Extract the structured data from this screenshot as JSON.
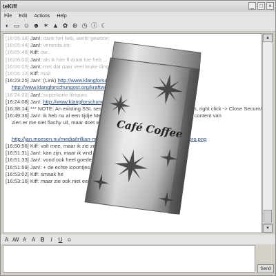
{
  "window": {
    "title": "teKiff"
  },
  "menu": [
    "File",
    "Edit",
    "Actions",
    "Help"
  ],
  "toolbar_icons": [
    "connect-icon",
    "folder-icon",
    "users-icon",
    "user-add-icon",
    "star-icon",
    "alert-icon",
    "settings-icon",
    "history-icon",
    "clock-icon",
    "info-icon",
    "moon-icon"
  ],
  "chat": {
    "lines": [
      {
        "ts": "[16:05:38]",
        "nick": "Jan!:",
        "msg": "dank het heb, werkt gewoon",
        "dim": true
      },
      {
        "ts": "[16:05:44]",
        "nick": "Jan!:",
        "msg": "veranda etc",
        "dim": true
      },
      {
        "ts": "[16:05:46]",
        "nick": "Kiff:",
        "msg": "ow...",
        "dim": true
      },
      {
        "ts": "[16:06:00]",
        "nick": "Jan!:",
        "msg": "als ik hier fl draai toe heb...",
        "dim": true
      },
      {
        "ts": "[16:06:05]",
        "nick": "Jan!:",
        "msg": "met dat daar veel leuke dingen",
        "dim": true
      },
      {
        "ts": "[16:06:12]",
        "nick": "Kiff:",
        "msg": "mail",
        "dim": true
      },
      {
        "ts": "[16:23:25]",
        "nick": "Jan!: (Link)",
        "msg": "",
        "dim": false,
        "link": "http://www.klangforschungost.org/kraftwerk_brussels04",
        "link2": "http://www.klangforschungost.org/kraftwerk_brussels04/vids/"
      },
      {
        "ts": "[16:24:02]",
        "nick": "Jan!:",
        "msg": "superkorte filmpjes",
        "dim": true
      },
      {
        "ts": "[16:24:08]",
        "nick": "Jan!:",
        "msg": "",
        "dim": false,
        "link": "http://www.klangforschungost.org/kraftwerk_brussels04/vids/"
      },
      {
        "ts": "[16:38:14]",
        "nick": "***",
        "msg": "NOTE: An existing SSL session exists with Kiff. To close this session, right click -> Close Secure/IM Session",
        "dim": false
      },
      {
        "ts": "[16:49:36]",
        "nick": "Jan!:",
        "msg": "ik heb nu al een tijdje Media Player 10 voor trillian, en ben er wel content van",
        "dim": false
      },
      {
        "ts": "",
        "nick": "",
        "msg": "zien er me niet flashy uit, maar doet wat het moet doen",
        "dim": false
      },
      {
        "ts": "",
        "nick": "",
        "msg": "",
        "dim": false,
        "link": "http://jan.moesen.nu/media/trillian-media-player-10-trillian-skin-windows-me-pro.png"
      },
      {
        "ts": "[16:50:56]",
        "nick": "Kiff:",
        "msg": "valt mee, maar ik zie ze weinig brg allemaal ondermaal",
        "dim": false
      },
      {
        "ts": "[16:51:31]",
        "nick": "Jan!:",
        "msg": "kan zijn, maar ik vind het wel",
        "dim": false
      },
      {
        "ts": "[16:51:33]",
        "nick": "Jan!:",
        "msg": "vond ook heel goede icons gemerkt die goed",
        "dim": false
      },
      {
        "ts": "[16:51:59]",
        "nick": "Jan!:",
        "msg": "+ de echte icoontjes",
        "dim": false
      },
      {
        "ts": "[16:53:02]",
        "nick": "Kiff:",
        "msg": "smaak he",
        "dim": false
      },
      {
        "ts": "[16:53:16]",
        "nick": "Kiff:",
        "msg": "maar zie ook niet een messagevensterke",
        "dim": false
      }
    ]
  },
  "overlay": {
    "label": "Café Coffee",
    "alt": "coffee bag product photo"
  },
  "format_icons": [
    "font-color-icon",
    "font-icon",
    "text-size-icon",
    "bold-icon",
    "italic-icon",
    "underline-icon",
    "emoticon-icon"
  ],
  "format_labels": [
    "A",
    "ꟿ",
    "A",
    "A",
    "B",
    "I",
    "U",
    "☺"
  ],
  "send_label": "Send"
}
